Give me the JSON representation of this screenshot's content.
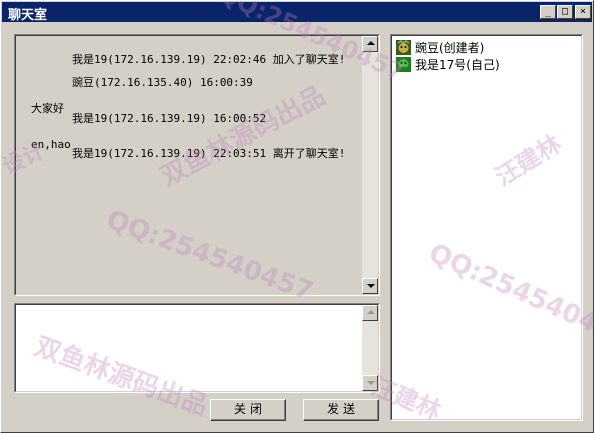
{
  "window": {
    "title": "聊天室",
    "buttons": {
      "minimize": "_",
      "maximize": "□",
      "close": "×"
    }
  },
  "chat": {
    "messages": [
      {
        "header": "我是19(172.16.139.19) 22:02:46 加入了聊天室!",
        "body": ""
      },
      {
        "header": "豌豆(172.16.135.40) 16:00:39",
        "body": "大家好"
      },
      {
        "header": "我是19(172.16.139.19) 16:00:52",
        "body": "en,hao"
      },
      {
        "header": "我是19(172.16.139.19) 22:03:51 离开了聊天室!",
        "body": ""
      }
    ]
  },
  "input": {
    "value": ""
  },
  "buttons": {
    "close": "关闭",
    "send": "发送"
  },
  "users": [
    {
      "name": "豌豆(创建者)",
      "icon": "pea-avatar-icon"
    },
    {
      "name": "我是17号(自己)",
      "icon": "green-avatar-icon"
    }
  ],
  "watermarks": {
    "qq": "QQ:254540457",
    "src": "双鱼林源码出品",
    "name": "汪建林",
    "design": "设计"
  },
  "colors": {
    "titlebar": "#0a246a",
    "window_bg": "#d4d0c8",
    "watermark": "#be82b9"
  }
}
